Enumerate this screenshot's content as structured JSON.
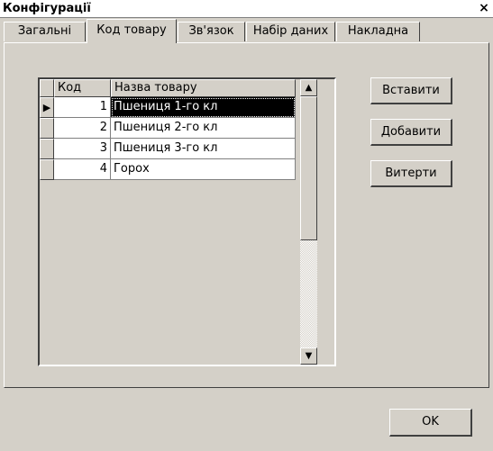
{
  "window": {
    "title": "Конфігурації",
    "close_glyph": "×"
  },
  "tabs": [
    {
      "label": "Загальні",
      "active": false
    },
    {
      "label": "Код товару",
      "active": true
    },
    {
      "label": "Зв'язок",
      "active": false
    },
    {
      "label": "Набір даних",
      "active": false
    },
    {
      "label": "Накладна",
      "active": false
    }
  ],
  "grid": {
    "columns": [
      "Код",
      "Назва товару"
    ],
    "rows": [
      {
        "code": "1",
        "name": "Пшениця 1-го кл",
        "selected": true,
        "indicator": "▶"
      },
      {
        "code": "2",
        "name": "Пшениця 2-го кл",
        "selected": false,
        "indicator": ""
      },
      {
        "code": "3",
        "name": "Пшениця 3-го кл",
        "selected": false,
        "indicator": ""
      },
      {
        "code": "4",
        "name": "Горох",
        "selected": false,
        "indicator": ""
      }
    ],
    "scroll_up_glyph": "▲",
    "scroll_down_glyph": "▼"
  },
  "buttons": {
    "insert_label": "Вставити",
    "add_label": "Добавити",
    "delete_label": "Витерти",
    "ok_label": "OK"
  },
  "colors": {
    "face": "#d4d0c8",
    "selection": "#000000"
  }
}
